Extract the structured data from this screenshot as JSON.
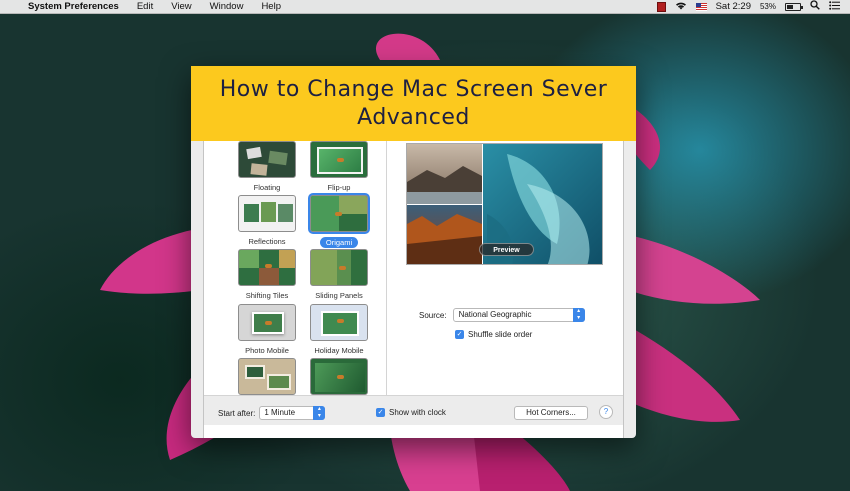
{
  "menubar": {
    "app_name": "System Preferences",
    "menus": [
      "Edit",
      "View",
      "Window",
      "Help"
    ],
    "time": "Sat 2:29",
    "battery_percent": "53%",
    "battery_level": 0.53
  },
  "banner": {
    "line1": "How to Change Mac Screen Sever",
    "line2": "Advanced"
  },
  "screensavers": [
    {
      "label": "Floating"
    },
    {
      "label": "Flip-up"
    },
    {
      "label": "Reflections"
    },
    {
      "label": "Origami",
      "selected": true
    },
    {
      "label": "Shifting Tiles"
    },
    {
      "label": "Sliding Panels"
    },
    {
      "label": "Photo Mobile"
    },
    {
      "label": "Holiday Mobile"
    }
  ],
  "preview": {
    "button_label": "Preview"
  },
  "options": {
    "source_label": "Source:",
    "source_value": "National Geographic",
    "shuffle_label": "Shuffle slide order",
    "shuffle_checked": true
  },
  "bottom": {
    "start_after_label": "Start after:",
    "start_after_value": "1 Minute",
    "show_clock_label": "Show with clock",
    "show_clock_checked": true,
    "hot_corners_label": "Hot Corners...",
    "help_label": "?"
  },
  "colors": {
    "accent": "#3a86e9",
    "banner_bg": "#fcc91e",
    "banner_text": "#1d2042"
  }
}
